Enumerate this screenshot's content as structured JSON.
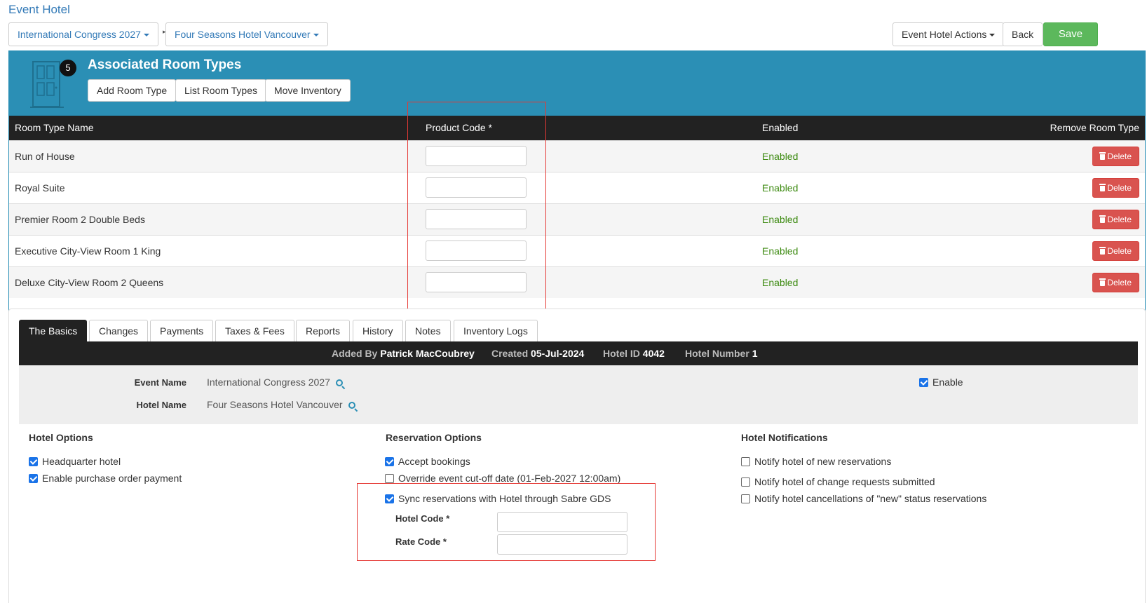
{
  "page": {
    "title": "Event Hotel"
  },
  "breadcrumb": {
    "event": "International Congress 2027",
    "separator": "▸",
    "hotel": "Four Seasons Hotel Vancouver"
  },
  "toolbar": {
    "actions_label": "Event Hotel Actions",
    "back_label": "Back",
    "save_label": "Save"
  },
  "room_types": {
    "count": "5",
    "title": "Associated Room Types",
    "buttons": {
      "add": "Add Room Type",
      "list": "List Room Types",
      "move": "Move Inventory"
    },
    "columns": [
      "Room Type Name",
      "Product Code *",
      "Enabled",
      "Remove Room Type"
    ],
    "rows": [
      {
        "name": "Run of House",
        "product_code": "",
        "enabled": "Enabled",
        "delete": "Delete"
      },
      {
        "name": "Royal Suite",
        "product_code": "",
        "enabled": "Enabled",
        "delete": "Delete"
      },
      {
        "name": "Premier Room 2 Double Beds",
        "product_code": "",
        "enabled": "Enabled",
        "delete": "Delete"
      },
      {
        "name": "Executive City-View Room 1 King",
        "product_code": "",
        "enabled": "Enabled",
        "delete": "Delete"
      },
      {
        "name": "Deluxe City-View Room 2 Queens",
        "product_code": "",
        "enabled": "Enabled",
        "delete": "Delete"
      }
    ]
  },
  "tabs": [
    "The Basics",
    "Changes",
    "Payments",
    "Taxes & Fees",
    "Reports",
    "History",
    "Notes",
    "Inventory Logs"
  ],
  "info_bar": {
    "added_by_label": "Added By",
    "added_by": "Patrick MacCoubrey",
    "created_label": "Created",
    "created": "05-Jul-2024",
    "hotel_id_label": "Hotel ID",
    "hotel_id": "4042",
    "hotel_number_label": "Hotel Number",
    "hotel_number": "1"
  },
  "basics": {
    "event_name_label": "Event Name",
    "event_name": "International Congress 2027",
    "hotel_name_label": "Hotel Name",
    "hotel_name": "Four Seasons Hotel Vancouver",
    "enable_label": "Enable",
    "enable_checked": true
  },
  "hotel_options": {
    "title": "Hotel Options",
    "items": [
      {
        "label": "Headquarter hotel",
        "checked": true
      },
      {
        "label": "Enable purchase order payment",
        "checked": true
      }
    ]
  },
  "reservation_options": {
    "title": "Reservation Options",
    "items": [
      {
        "label": "Accept bookings",
        "checked": true
      },
      {
        "label": "Override event cut-off date (01-Feb-2027 12:00am)",
        "checked": false
      },
      {
        "label": "Sync reservations with Hotel through Sabre GDS",
        "checked": true
      }
    ],
    "hotel_code_label": "Hotel Code *",
    "hotel_code": "",
    "rate_code_label": "Rate Code *",
    "rate_code": ""
  },
  "hotel_notifications": {
    "title": "Hotel Notifications",
    "items": [
      {
        "label": "Notify hotel of new reservations",
        "checked": false
      },
      {
        "label": "Notify hotel of change requests submitted",
        "checked": false
      },
      {
        "label": "Notify hotel cancellations of \"new\" status reservations",
        "checked": false
      }
    ]
  },
  "colors": {
    "accent": "#2b8fb5",
    "save": "#5cb85c",
    "delete": "#d9534f",
    "enabled": "#3c8a10",
    "highlight": "#e53935"
  }
}
